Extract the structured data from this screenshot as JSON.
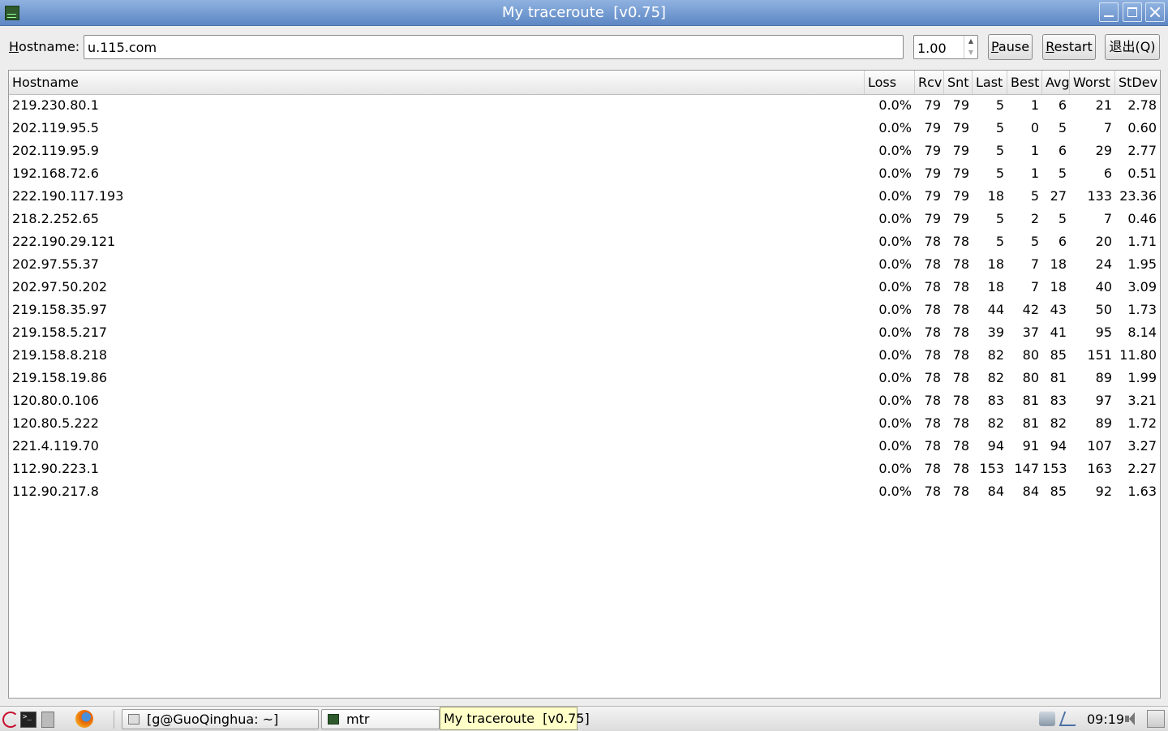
{
  "window": {
    "title": "My traceroute  [v0.75]"
  },
  "toolbar": {
    "hostname_label_mnemonic": "H",
    "hostname_label_rest": "ostname:",
    "hostname_value": "u.115.com",
    "interval_value": "1.00",
    "pause_mnemonic": "P",
    "pause_rest": "ause",
    "restart_mnemonic": "R",
    "restart_rest": "estart",
    "quit_label": "退出(Q)"
  },
  "table": {
    "columns": [
      "Hostname",
      "Loss",
      "Rcv",
      "Snt",
      "Last",
      "Best",
      "Avg",
      "Worst",
      "StDev"
    ],
    "rows": [
      [
        "219.230.80.1",
        "0.0%",
        "79",
        "79",
        "5",
        "1",
        "6",
        "21",
        "2.78"
      ],
      [
        "202.119.95.5",
        "0.0%",
        "79",
        "79",
        "5",
        "0",
        "5",
        "7",
        "0.60"
      ],
      [
        "202.119.95.9",
        "0.0%",
        "79",
        "79",
        "5",
        "1",
        "6",
        "29",
        "2.77"
      ],
      [
        "192.168.72.6",
        "0.0%",
        "79",
        "79",
        "5",
        "1",
        "5",
        "6",
        "0.51"
      ],
      [
        "222.190.117.193",
        "0.0%",
        "79",
        "79",
        "18",
        "5",
        "27",
        "133",
        "23.36"
      ],
      [
        "218.2.252.65",
        "0.0%",
        "79",
        "79",
        "5",
        "2",
        "5",
        "7",
        "0.46"
      ],
      [
        "222.190.29.121",
        "0.0%",
        "78",
        "78",
        "5",
        "5",
        "6",
        "20",
        "1.71"
      ],
      [
        "202.97.55.37",
        "0.0%",
        "78",
        "78",
        "18",
        "7",
        "18",
        "24",
        "1.95"
      ],
      [
        "202.97.50.202",
        "0.0%",
        "78",
        "78",
        "18",
        "7",
        "18",
        "40",
        "3.09"
      ],
      [
        "219.158.35.97",
        "0.0%",
        "78",
        "78",
        "44",
        "42",
        "43",
        "50",
        "1.73"
      ],
      [
        "219.158.5.217",
        "0.0%",
        "78",
        "78",
        "39",
        "37",
        "41",
        "95",
        "8.14"
      ],
      [
        "219.158.8.218",
        "0.0%",
        "78",
        "78",
        "82",
        "80",
        "85",
        "151",
        "11.80"
      ],
      [
        "219.158.19.86",
        "0.0%",
        "78",
        "78",
        "82",
        "80",
        "81",
        "89",
        "1.99"
      ],
      [
        "120.80.0.106",
        "0.0%",
        "78",
        "78",
        "83",
        "81",
        "83",
        "97",
        "3.21"
      ],
      [
        "120.80.5.222",
        "0.0%",
        "78",
        "78",
        "82",
        "81",
        "82",
        "89",
        "1.72"
      ],
      [
        "221.4.119.70",
        "0.0%",
        "78",
        "78",
        "94",
        "91",
        "94",
        "107",
        "3.27"
      ],
      [
        "112.90.223.1",
        "0.0%",
        "78",
        "78",
        "153",
        "147",
        "153",
        "163",
        "2.27"
      ],
      [
        "112.90.217.8",
        "0.0%",
        "78",
        "78",
        "84",
        "84",
        "85",
        "92",
        "1.63"
      ]
    ]
  },
  "taskbar": {
    "terminal_task": "[g@GuoQinghua: ~]",
    "mtr_task": "mtr",
    "tooltip": "My traceroute  [v0.75]",
    "clock": "09:19"
  }
}
